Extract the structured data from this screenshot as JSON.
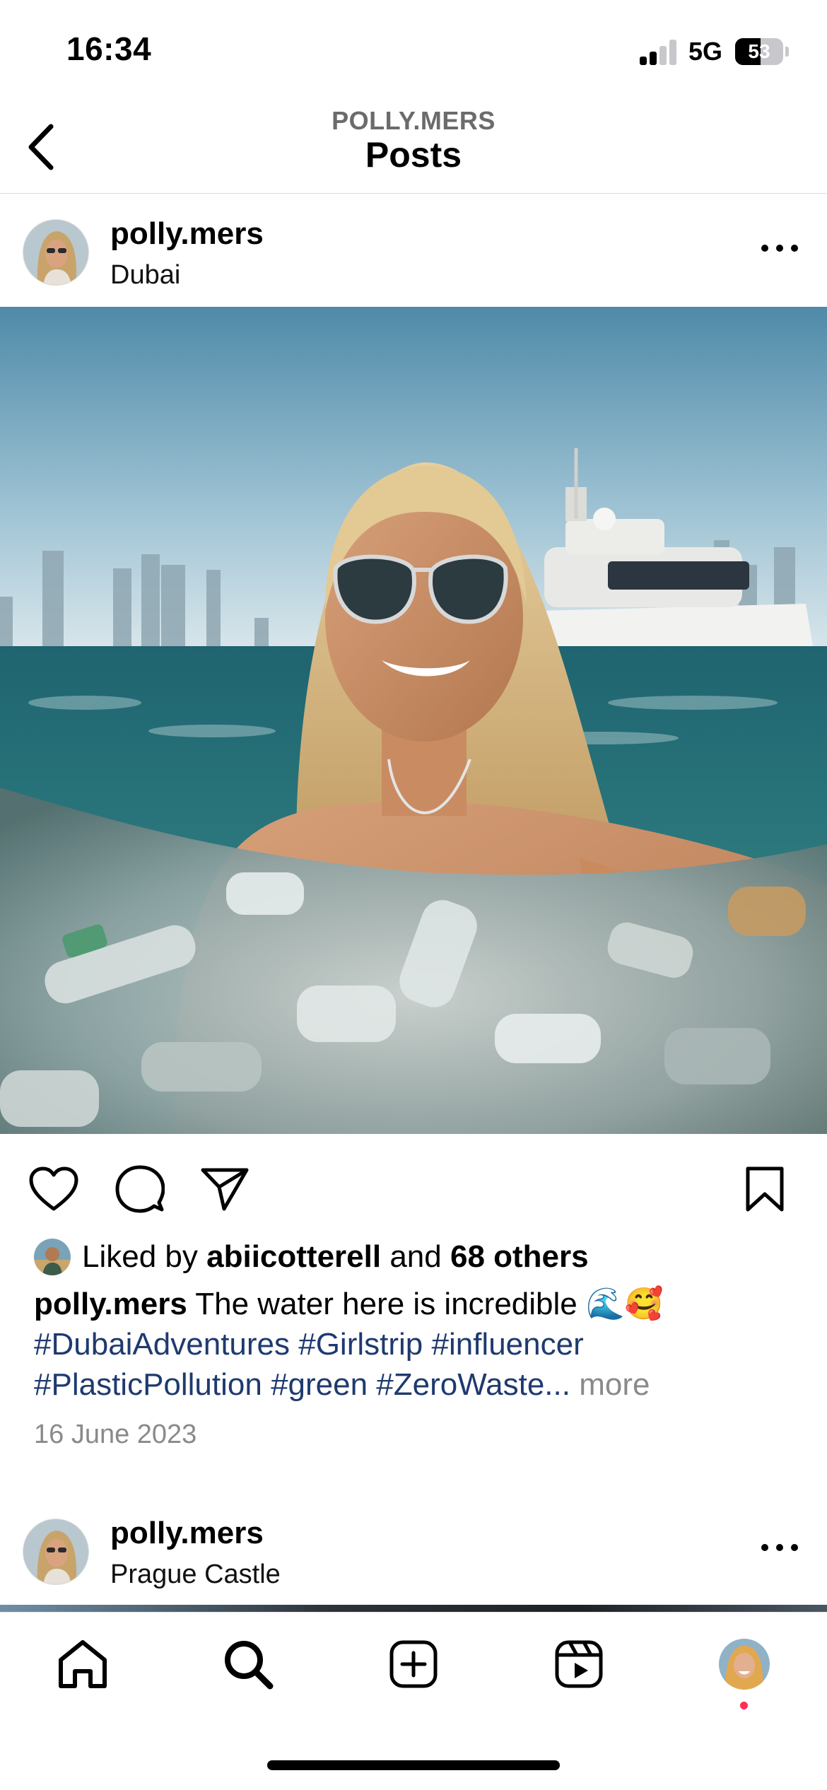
{
  "status_bar": {
    "time": "16:34",
    "network": "5G",
    "battery": "53",
    "battery_level_fraction": 0.53
  },
  "header": {
    "back_icon": "chevron-left-icon",
    "subtitle": "POLLY.MERS",
    "title": "Posts"
  },
  "posts": [
    {
      "username": "polly.mers",
      "location": "Dubai",
      "more_icon": "ellipsis-icon",
      "liked_by_prefix": "Liked by",
      "liked_by_user": "abiicotterell",
      "liked_by_and": "and",
      "liked_by_others": "68 others",
      "caption_user": "polly.mers",
      "caption_text": "The water here is incredible 🌊🥰",
      "hashtags_line1": "#DubaiAdventures #Girlstrip #influencer",
      "hashtags_line2": "#PlasticPollution #green #ZeroWaste...",
      "more_label": "more",
      "date": "16 June 2023"
    },
    {
      "username": "polly.mers",
      "location": "Prague Castle",
      "more_icon": "ellipsis-icon"
    }
  ],
  "actions": {
    "like_icon": "heart-icon",
    "comment_icon": "comment-icon",
    "share_icon": "send-icon",
    "save_icon": "bookmark-icon"
  },
  "bottom_nav": {
    "items": [
      "home-icon",
      "search-icon",
      "create-icon",
      "reels-icon",
      "profile-avatar"
    ]
  },
  "colors": {
    "hashtag": "#1e3a6f",
    "muted": "#8a8a8a",
    "notification_dot": "#ff2d55"
  }
}
